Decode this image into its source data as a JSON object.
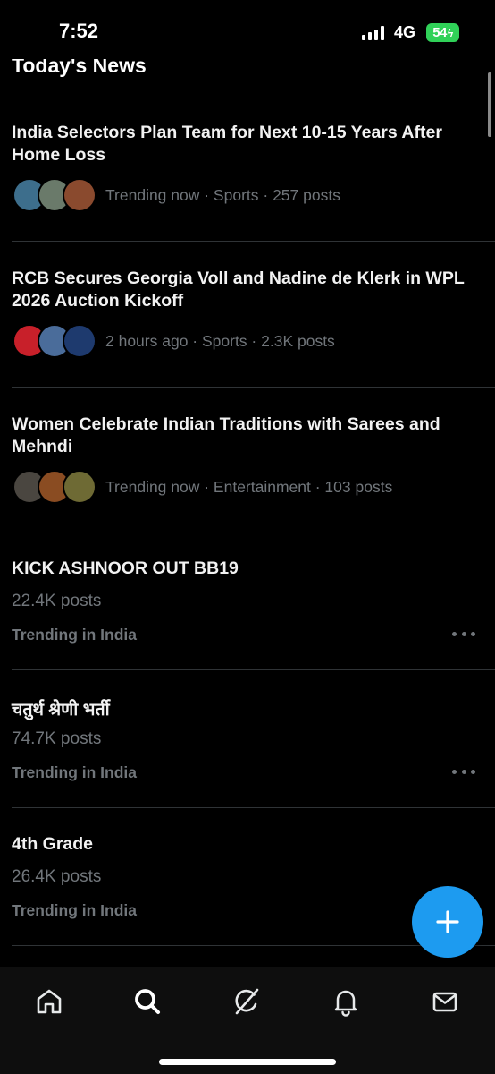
{
  "status_bar": {
    "time": "7:52",
    "network": "4G",
    "battery": "54",
    "battery_color": "#30d158"
  },
  "section": {
    "title": "Today's News"
  },
  "news": [
    {
      "headline": "India Selectors Plan Team for Next 10-15 Years After Home Loss",
      "meta": "Trending now · Sports · 257 posts",
      "avatar_colors": [
        "#3d6e8c",
        "#6a7a6a",
        "#8a4a2e"
      ]
    },
    {
      "headline": "RCB Secures Georgia Voll and Nadine de Klerk in WPL 2026 Auction Kickoff",
      "meta": "2 hours ago · Sports · 2.3K posts",
      "avatar_colors": [
        "#c8202a",
        "#4a6c9a",
        "#1e3a6e"
      ]
    },
    {
      "headline": "Women Celebrate Indian Traditions with Sarees and Mehndi",
      "meta": "Trending now · Entertainment · 103 posts",
      "avatar_colors": [
        "#4a4640",
        "#8a4c22",
        "#6e6a34"
      ]
    }
  ],
  "trends": [
    {
      "title": "KICK ASHNOOR OUT BB19",
      "count": "22.4K posts",
      "context": "Trending in India"
    },
    {
      "title": "चतुर्थ श्रेणी भर्ती",
      "count": "74.7K posts",
      "context": "Trending in India"
    },
    {
      "title": "4th Grade",
      "count": "26.4K posts",
      "context": "Trending in India"
    }
  ],
  "fab": {
    "icon": "plus-icon",
    "color": "#1d9bf0"
  },
  "bottom_nav": [
    {
      "icon": "home-icon"
    },
    {
      "icon": "search-icon"
    },
    {
      "icon": "grok-icon"
    },
    {
      "icon": "bell-icon"
    },
    {
      "icon": "mail-icon"
    }
  ]
}
